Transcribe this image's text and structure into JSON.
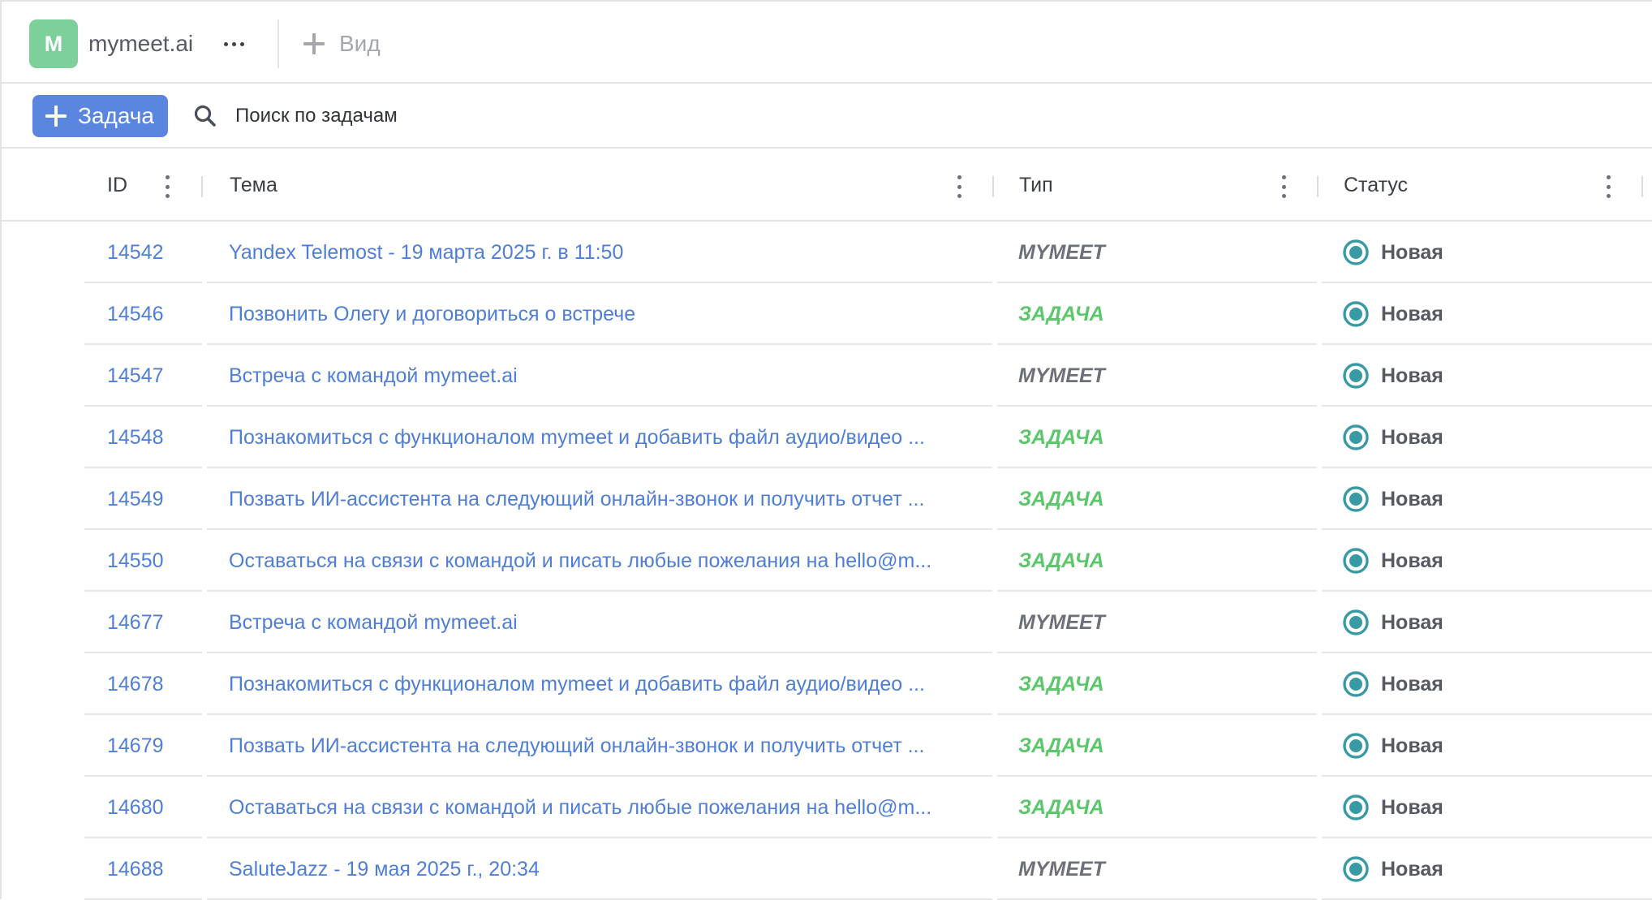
{
  "project": {
    "avatar_letter": "M",
    "avatar_color": "#7ed09a",
    "name": "mymeet.ai",
    "more_icon": "more-horizontal-icon",
    "add_view_label": "Вид"
  },
  "toolbar": {
    "new_task_label": "Задача",
    "new_task_color": "#5b86df",
    "search_placeholder": "Поиск по задачам",
    "search_value": ""
  },
  "table": {
    "columns": {
      "id": "ID",
      "subject": "Тема",
      "type": "Тип",
      "status": "Статус"
    },
    "type_colors": {
      "MYMEET": "#6b7079",
      "ЗАДАЧА": "#5cc76a"
    },
    "status_color": "#3a9aa3",
    "rows": [
      {
        "id": "14542",
        "subject": "Yandex Telemost - 19 марта 2025 г. в 11:50",
        "type": "MYMEET",
        "status": "Новая"
      },
      {
        "id": "14546",
        "subject": "Позвонить Олегу и договориться о встрече",
        "type": "ЗАДАЧА",
        "status": "Новая"
      },
      {
        "id": "14547",
        "subject": "Встреча с командой mymeet.ai",
        "type": "MYMEET",
        "status": "Новая"
      },
      {
        "id": "14548",
        "subject": "Познакомиться с функционалом mymeet и добавить файл аудио/видео ...",
        "type": "ЗАДАЧА",
        "status": "Новая"
      },
      {
        "id": "14549",
        "subject": "Позвать ИИ-ассистента на следующий онлайн-звонок и получить отчет ...",
        "type": "ЗАДАЧА",
        "status": "Новая"
      },
      {
        "id": "14550",
        "subject": "Оставаться на связи с командой и писать любые пожелания на hello@m...",
        "type": "ЗАДАЧА",
        "status": "Новая"
      },
      {
        "id": "14677",
        "subject": "Встреча с командой mymeet.ai",
        "type": "MYMEET",
        "status": "Новая"
      },
      {
        "id": "14678",
        "subject": "Познакомиться с функционалом mymeet и добавить файл аудио/видео ...",
        "type": "ЗАДАЧА",
        "status": "Новая"
      },
      {
        "id": "14679",
        "subject": "Позвать ИИ-ассистента на следующий онлайн-звонок и получить отчет ...",
        "type": "ЗАДАЧА",
        "status": "Новая"
      },
      {
        "id": "14680",
        "subject": "Оставаться на связи с командой и писать любые пожелания на hello@m...",
        "type": "ЗАДАЧА",
        "status": "Новая"
      },
      {
        "id": "14688",
        "subject": "SaluteJazz - 19 мая 2025 г., 20:34",
        "type": "MYMEET",
        "status": "Новая"
      }
    ]
  }
}
